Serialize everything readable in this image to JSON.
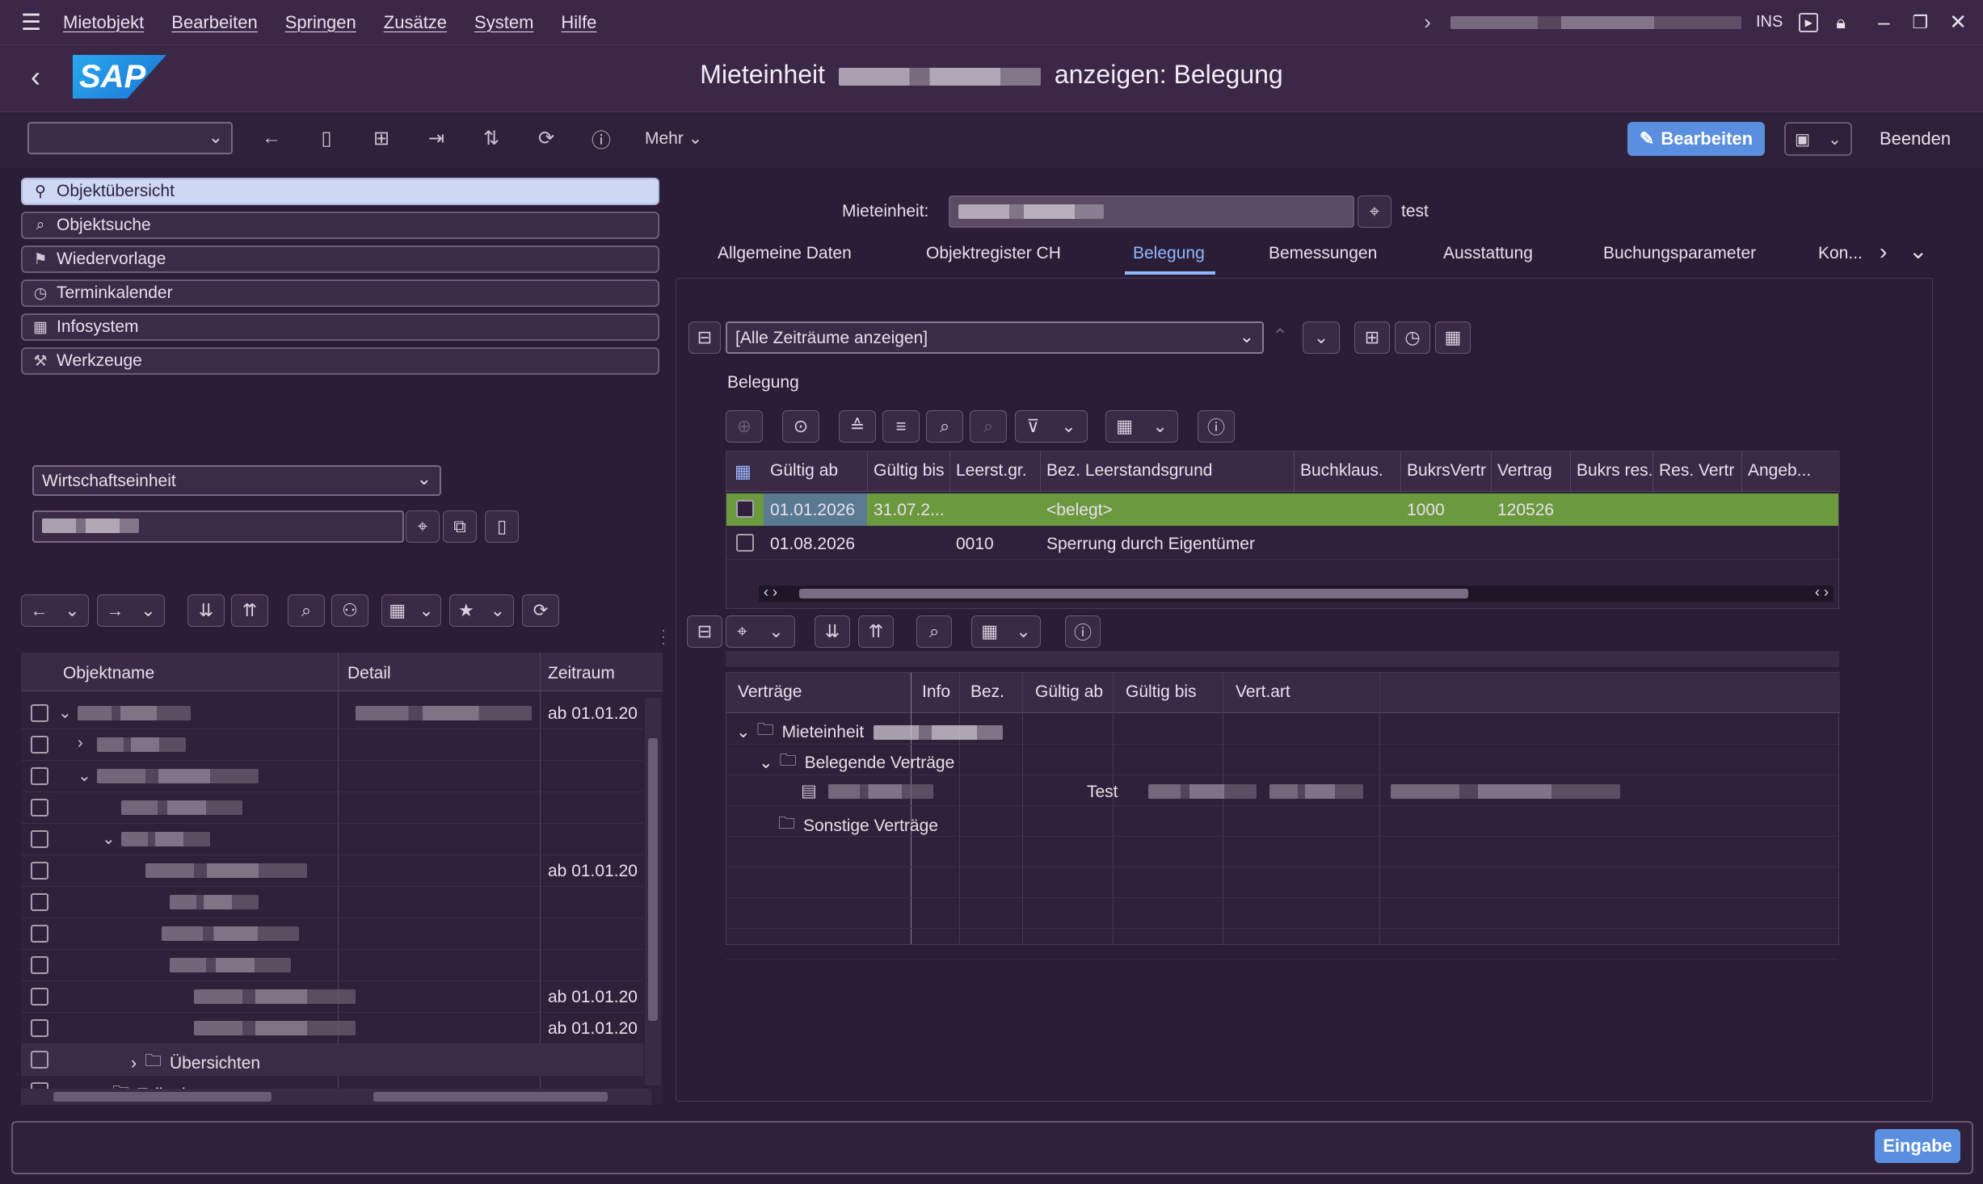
{
  "menubar": {
    "items": [
      "Mietobjekt",
      "Bearbeiten",
      "Springen",
      "Zusätze",
      "System",
      "Hilfe"
    ],
    "ins_label": "INS"
  },
  "title": {
    "prefix": "Mieteinheit",
    "suffix": "anzeigen: Belegung",
    "logo_text": "SAP"
  },
  "toolbar": {
    "more_label": "Mehr",
    "edit_label": "Bearbeiten",
    "exit_label": "Beenden"
  },
  "nav": {
    "items": [
      "Objektübersicht",
      "Objektsuche",
      "Wiedervorlage",
      "Terminkalender",
      "Infosystem",
      "Werkzeuge"
    ]
  },
  "left": {
    "dropdown_value": "Wirtschaftseinheit",
    "tree_headers": [
      "Objektname",
      "Detail",
      "Zeitraum"
    ],
    "zeitraum_values": [
      "ab 01.01.20",
      "ab 01.01.20",
      "ab 01.01.20",
      "ab 01.01.20"
    ],
    "tree_folder_1": "Übersichten",
    "tree_folder_2": "Teilnahmegruppen"
  },
  "header_field": {
    "label": "Mieteinheit:",
    "extra_text": "test"
  },
  "tabs": [
    "Allgemeine Daten",
    "Objektregister CH",
    "Belegung",
    "Bemessungen",
    "Ausstattung",
    "Buchungsparameter",
    "Kon..."
  ],
  "period_select": "[Alle Zeiträume anzeigen]",
  "belegung": {
    "section_title": "Belegung",
    "headers": [
      "Gültig ab",
      "Gültig bis",
      "Leerst.gr.",
      "Bez. Leerstandsgrund",
      "Buchklaus.",
      "BukrsVertr",
      "Vertrag",
      "Bukrs res.",
      "Res. Vertr",
      "Angeb..."
    ],
    "rows": [
      {
        "gueltig_ab": "01.01.2026",
        "gueltig_bis": "31.07.2...",
        "leerst": "",
        "bez": "<belegt>",
        "buchklaus": "",
        "bukrs": "1000",
        "vertrag": "120526"
      },
      {
        "gueltig_ab": "01.08.2026",
        "gueltig_bis": "",
        "leerst": "0010",
        "bez": "Sperrung durch Eigentümer",
        "buchklaus": "",
        "bukrs": "",
        "vertrag": ""
      }
    ]
  },
  "vertraege": {
    "headers": [
      "Verträge",
      "Info",
      "Bez.",
      "Gültig ab",
      "Gültig bis",
      "Vert.art"
    ],
    "node_mieteinheit": "Mieteinheit",
    "node_belegende": "Belegende Verträge",
    "contract_bez": "Test",
    "node_sonstige": "Sonstige Verträge"
  },
  "footer": {
    "enter_label": "Eingabe"
  },
  "colors": {
    "accent": "#5a8fe0",
    "row_selected": "#6b9a3e",
    "background": "#2b1d35"
  }
}
